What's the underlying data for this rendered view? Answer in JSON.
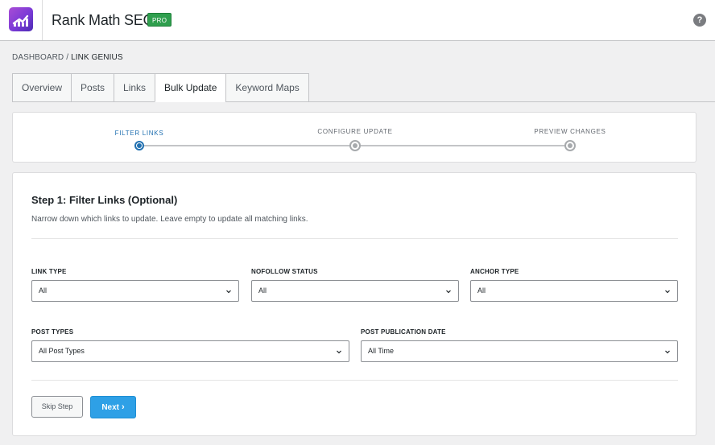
{
  "header": {
    "app_title": "Rank Math SEO",
    "badge": "PRO",
    "help_glyph": "?",
    "logo_icon": "rank-math-logo-icon",
    "colors": {
      "badge_bg": "#2f9f4e",
      "logo_gradient_start": "#a94dd6",
      "logo_gradient_end": "#4b2bb3"
    }
  },
  "breadcrumb": {
    "root": "DASHBOARD",
    "separator": "/",
    "current": "LINK GENIUS"
  },
  "tabs": [
    {
      "label": "Overview",
      "active": false
    },
    {
      "label": "Posts",
      "active": false
    },
    {
      "label": "Links",
      "active": false
    },
    {
      "label": "Bulk Update",
      "active": true
    },
    {
      "label": "Keyword Maps",
      "active": false
    }
  ],
  "stepper": {
    "steps": [
      {
        "label": "FILTER LINKS",
        "state": "active"
      },
      {
        "label": "CONFIGURE UPDATE",
        "state": "pending"
      },
      {
        "label": "PREVIEW CHANGES",
        "state": "pending"
      }
    ],
    "colors": {
      "active": "#2271b1",
      "pending": "#a7aaad"
    }
  },
  "step1": {
    "title": "Step 1: Filter Links (Optional)",
    "description": "Narrow down which links to update. Leave empty to update all matching links.",
    "fields": {
      "link_type": {
        "label": "LINK TYPE",
        "value": "All"
      },
      "nofollow_status": {
        "label": "NOFOLLOW STATUS",
        "value": "All"
      },
      "anchor_type": {
        "label": "ANCHOR TYPE",
        "value": "All"
      },
      "post_types": {
        "label": "POST TYPES",
        "value": "All Post Types"
      },
      "post_date": {
        "label": "POST PUBLICATION DATE",
        "value": "All Time"
      }
    },
    "buttons": {
      "skip": "Skip Step",
      "next": "Next",
      "next_glyph": "›"
    },
    "colors": {
      "next_bg": "#2ea0e6"
    }
  }
}
